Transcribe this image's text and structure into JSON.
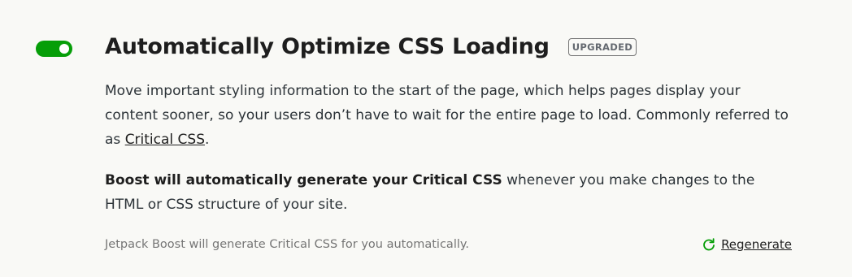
{
  "module": {
    "enabled": true,
    "title": "Automatically Optimize CSS Loading",
    "badge": "UPGRADED",
    "description": {
      "before_link": "Move important styling information to the start of the page, which helps pages display your content sooner, so your users don’t have to wait for the entire page to load. Commonly referred to as ",
      "link_text": "Critical CSS",
      "after_link": "."
    },
    "auto_note": {
      "bold": "Boost will automatically generate your Critical CSS",
      "rest": " whenever you make changes to the HTML or CSS structure of your site."
    },
    "status_text": "Jetpack Boost will generate Critical CSS for you automatically.",
    "regenerate_label": "Regenerate"
  },
  "colors": {
    "toggle_on": "#069e08",
    "regenerate_icon": "#069e08",
    "background": "#f9f9f6"
  },
  "icons": {
    "regenerate": "refresh-icon"
  }
}
